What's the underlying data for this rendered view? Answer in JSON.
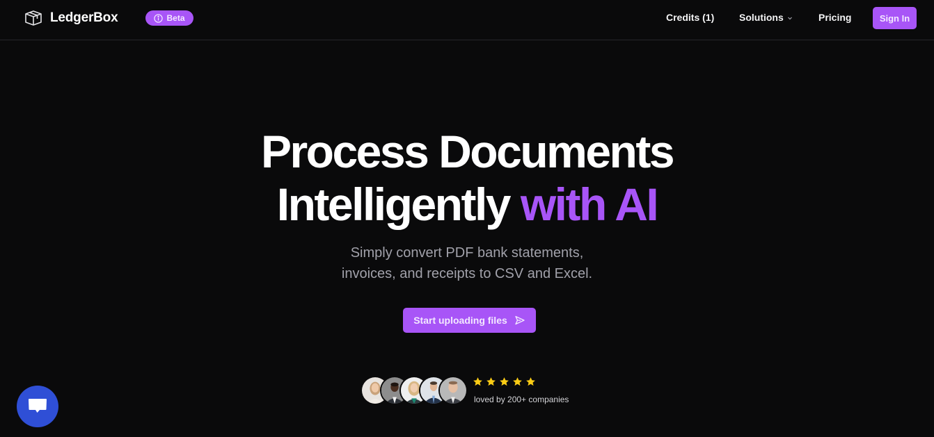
{
  "header": {
    "brand": "LedgerBox",
    "badge_label": "Beta",
    "nav": {
      "credits": "Credits (1)",
      "solutions": "Solutions",
      "pricing": "Pricing"
    },
    "signin_label": "Sign In"
  },
  "hero": {
    "title_line1": "Process Documents",
    "title_line2_plain": "Intelligently",
    "title_line2_accent": "with AI",
    "subtitle_line1": "Simply convert PDF bank statements,",
    "subtitle_line2": "invoices, and receipts to CSV and Excel.",
    "cta_label": "Start uploading files"
  },
  "social_proof": {
    "avatar_count": 5,
    "rating": 5,
    "rating_max": 5,
    "text": "loved by 200+ companies"
  },
  "icons": {
    "logo": "box-icon",
    "badge": "info-icon",
    "solutions": "chevron-down-icon",
    "cta": "send-icon",
    "chat": "chat-bubble-icon",
    "rating": "star-icon"
  },
  "colors": {
    "background": "#0a0a0b",
    "accent": "#a855f7",
    "chat_button": "#2f4fd6",
    "star": "#facc15",
    "subtitle": "#a1a1aa"
  }
}
